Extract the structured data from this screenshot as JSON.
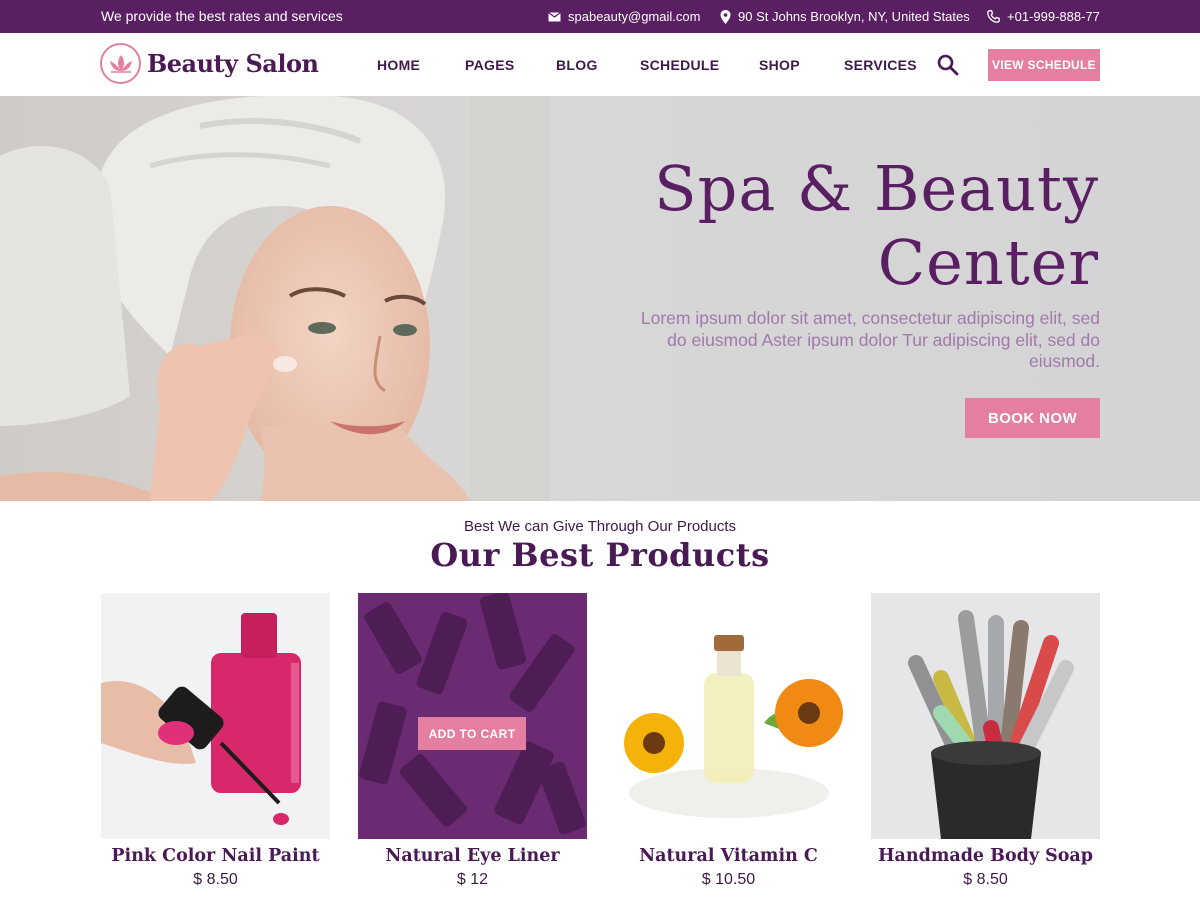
{
  "topbar": {
    "tagline": "We provide the best rates and services",
    "email": "spabeauty@gmail.com",
    "address": "90 St Johns Brooklyn, NY, United States",
    "phone": "+01-999-888-77"
  },
  "header": {
    "logo_text": "Beauty Salon",
    "nav": [
      "HOME",
      "PAGES",
      "BLOG",
      "SCHEDULE",
      "SHOP",
      "SERVICES"
    ],
    "cta": "VIEW SCHEDULE"
  },
  "hero": {
    "title": "Spa & Beauty\nCenter",
    "text": "Lorem ipsum dolor sit amet, consectetur adipiscing elit, sed do eiusmod Aster ipsum dolor Tur adipiscing elit, sed do eiusmod.",
    "cta": "BOOK NOW"
  },
  "products": {
    "eyebrow": "Best We can Give Through Our Products",
    "title": "Our Best Products",
    "add_to_cart": "ADD TO CART",
    "items": [
      {
        "name": "Pink Color Nail Paint",
        "price": "$ 8.50"
      },
      {
        "name": "Natural Eye Liner",
        "price": "$ 12"
      },
      {
        "name": "Natural Vitamin C",
        "price": "$ 10.50"
      },
      {
        "name": "Handmade Body Soap",
        "price": "$ 8.50"
      }
    ]
  },
  "colors": {
    "brand_purple": "#5a1f62",
    "accent_pink": "#e57fa1",
    "muted_text": "#a17aab"
  },
  "icons": [
    "mail-icon",
    "location-pin-icon",
    "phone-icon",
    "lotus-logo-icon",
    "search-icon"
  ]
}
